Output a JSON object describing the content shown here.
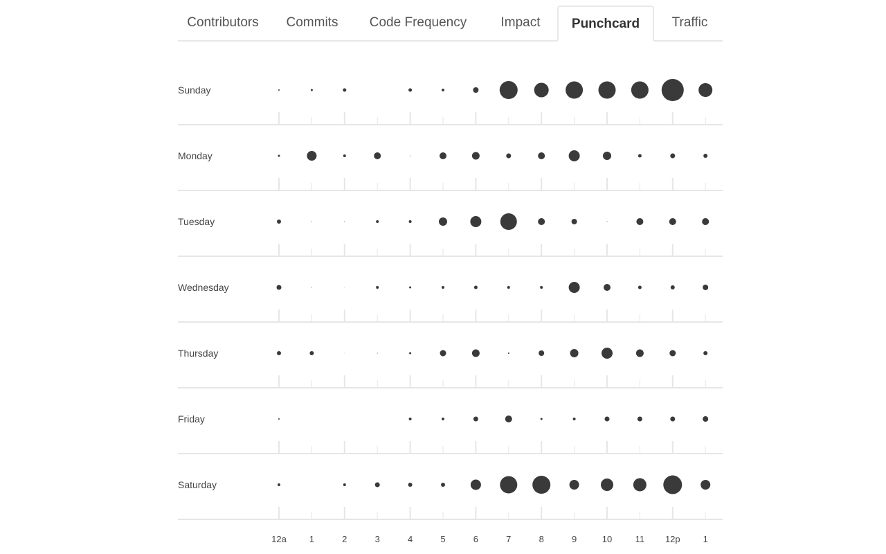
{
  "tabs": [
    {
      "label": "Contributors",
      "active": false
    },
    {
      "label": "Commits",
      "active": false
    },
    {
      "label": "Code Frequency",
      "active": false
    },
    {
      "label": "Impact",
      "active": false
    },
    {
      "label": "Punchcard",
      "active": true
    },
    {
      "label": "Traffic",
      "active": false
    }
  ],
  "colors": {
    "dot": "#3a3a3a",
    "grid": "#e6e6e6"
  },
  "chart_data": {
    "type": "scatter",
    "title": "Punchcard",
    "xlabel": "",
    "ylabel": "",
    "categories_x": [
      "12a",
      "1",
      "2",
      "3",
      "4",
      "5",
      "6",
      "7",
      "8",
      "9",
      "10",
      "11",
      "12p",
      "1"
    ],
    "categories_y": [
      "Sunday",
      "Monday",
      "Tuesday",
      "Wednesday",
      "Thursday",
      "Friday",
      "Saturday"
    ],
    "value_note": "relative commit volume (dot radius scale, max = 16)",
    "series": [
      {
        "name": "Sunday",
        "values": [
          1,
          1.5,
          2.5,
          0,
          2.5,
          2,
          4,
          13,
          10.5,
          12.5,
          12.5,
          12.5,
          16,
          10
        ]
      },
      {
        "name": "Monday",
        "values": [
          1.5,
          7,
          2,
          5,
          0.5,
          5,
          5.5,
          3.5,
          5,
          8,
          6,
          2.5,
          3.5,
          3
        ]
      },
      {
        "name": "Tuesday",
        "values": [
          3,
          0.5,
          0.5,
          2,
          2,
          6,
          8,
          12,
          5,
          4,
          0.5,
          5,
          5,
          5
        ]
      },
      {
        "name": "Wednesday",
        "values": [
          3.5,
          0.5,
          0.3,
          2,
          1.5,
          2,
          2.5,
          2,
          2,
          8,
          5,
          2.5,
          3,
          4
        ]
      },
      {
        "name": "Thursday",
        "values": [
          3,
          3,
          0.3,
          0.5,
          1.5,
          4.5,
          5.5,
          1,
          4,
          6,
          8,
          5.5,
          4.5,
          3
        ]
      },
      {
        "name": "Friday",
        "values": [
          1,
          0,
          0,
          0,
          2,
          2,
          3.5,
          5,
          1.5,
          2,
          3.5,
          3.5,
          3.5,
          4
        ]
      },
      {
        "name": "Saturday",
        "values": [
          2,
          0,
          2,
          3.5,
          3,
          3,
          7.5,
          12.5,
          13,
          7,
          9,
          9.5,
          13.5,
          7
        ]
      }
    ],
    "grid": true,
    "legend": "none"
  }
}
